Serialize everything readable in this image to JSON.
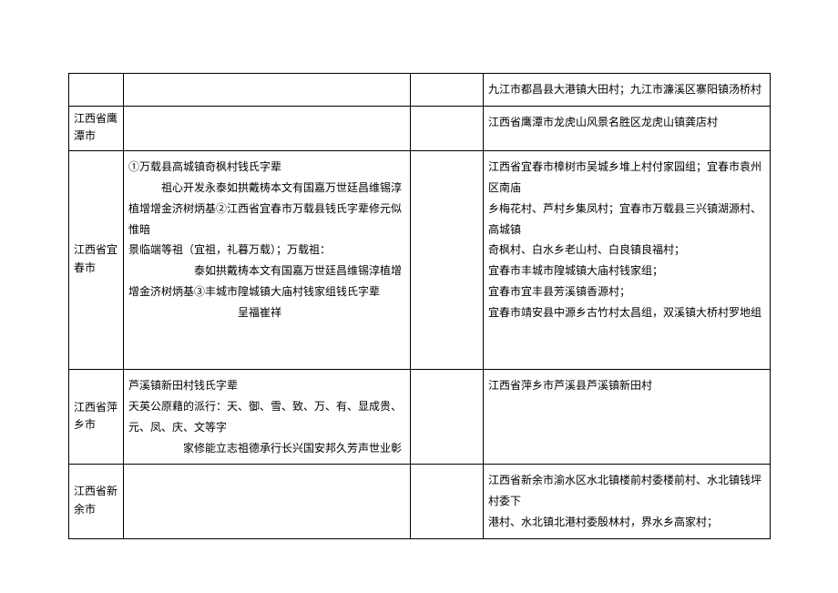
{
  "rows": [
    {
      "region": "",
      "col2": "",
      "col3": "",
      "col4": "九江市都昌县大港镇大田村；九江市濂溪区寨阳镇汤桥村"
    },
    {
      "region": "江西省鹰潭市",
      "col2": "",
      "col3": "",
      "col4": "江西省鹰潭市龙虎山风景名胜区龙虎山镇龚店村"
    },
    {
      "region": "江西省宜春市",
      "col2_lines": [
        "①万载县高城镇奇枫村钱氏字辈",
        "　　　祖心开发永泰如拱戴梼本文有国嘉万世廷昌维锡淳",
        "植增增金济树炳基②江西省宜春市万载县钱氏字辈修元似惟暗",
        "景临端等祖（宜祖，礼暮万载）；万载祖：",
        "　　　　　　泰如拱戴梼本文有国嘉万世廷昌维锡淳植增",
        "增金济树炳基③丰城市隍城镇大庙村钱家组钱氏字辈",
        "　　　　　　　　　　呈福崔祥"
      ],
      "col3": "",
      "col4_lines": [
        "江西省宜春市樟树市吴城乡堆上村付家园组；宜春市袁州区南庙",
        "乡梅花村、芦村乡集凤村；宜春市万载县三兴镇湖源村、高城镇",
        "奇枫村、白水乡老山村、白良镇良福村；",
        "宜春市丰城市隍城镇大庙村钱家组；",
        "宜春市宜丰县芳溪镇香源村；",
        "宜春市靖安县中源乡古竹村太昌组，双溪镇大桥村罗地组"
      ]
    },
    {
      "region": "江西省萍乡市",
      "col2_lines": [
        "芦溪镇新田村钱氏字辈",
        "天英公原藉的派行：天、御、雪、致、万、有、显成贵、元、凤、庆、文等字",
        "　　　　　家修能立志祖德承行长兴国安邦久芳声世业彰"
      ],
      "col3": "",
      "col4": "江西省萍乡市芦溪县芦溪镇新田村"
    },
    {
      "region": "江西省新余市",
      "col2": "",
      "col3": "",
      "col4_lines": [
        "江西省新余市渝水区水北镇楼前村委楼前村、水北镇钱坪村委下",
        "港村、水北镇北港村委殷林村，界水乡高家村；"
      ]
    }
  ]
}
